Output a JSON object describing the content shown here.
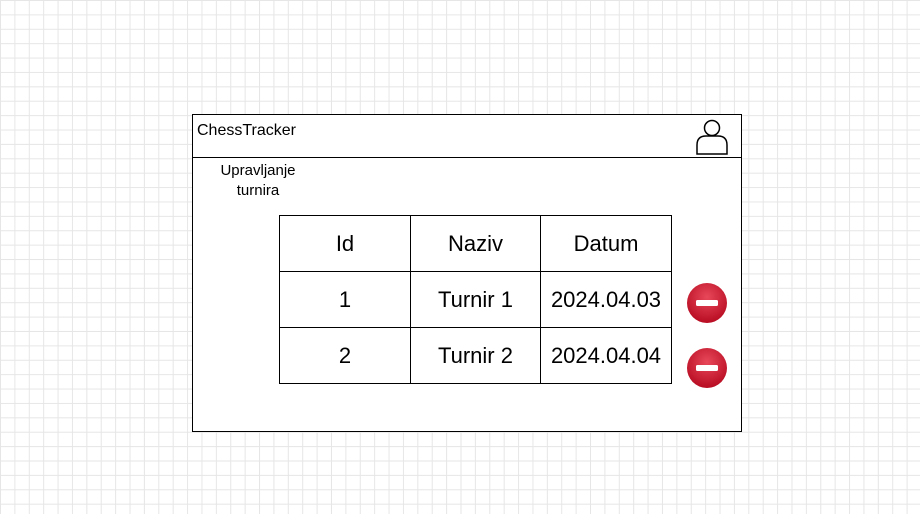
{
  "app": {
    "title": "ChessTracker"
  },
  "header": {
    "user_icon": "user-icon"
  },
  "page": {
    "section_title_line1": "Upravljanje",
    "section_title_line2": "turnira"
  },
  "table": {
    "columns": [
      "Id",
      "Naziv",
      "Datum"
    ],
    "rows": [
      {
        "id": "1",
        "naziv": "Turnir 1",
        "datum": "2024.04.03"
      },
      {
        "id": "2",
        "naziv": "Turnir 2",
        "datum": "2024.04.04"
      }
    ],
    "delete_icon": "minus-circle-icon"
  },
  "colors": {
    "delete_red": "#c8102e",
    "grid": "#e6e6e6"
  }
}
